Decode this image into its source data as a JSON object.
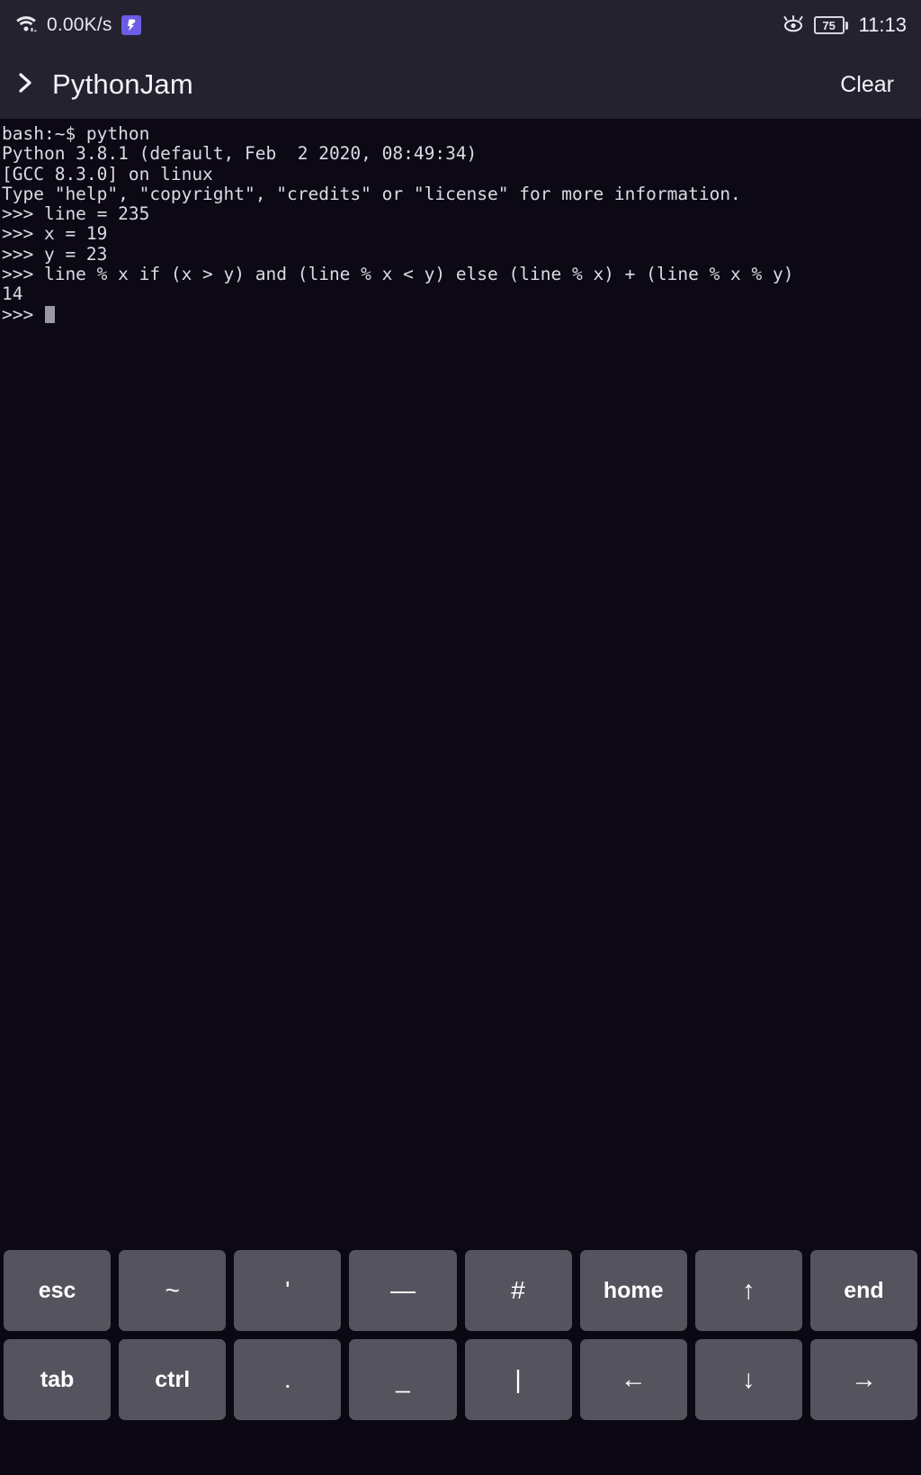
{
  "status_bar": {
    "network_speed": "0.00K/s",
    "wifi_icon": "wifi-icon",
    "app_notification_icon": "app-notification-icon",
    "eye_care_icon": "eye-care-icon",
    "battery_level": "75",
    "time": "11:13"
  },
  "app_header": {
    "back_icon": "chevron-right-icon",
    "title": "PythonJam",
    "clear_label": "Clear"
  },
  "terminal": {
    "lines": [
      "bash:~$ python",
      "Python 3.8.1 (default, Feb  2 2020, 08:49:34)",
      "[GCC 8.3.0] on linux",
      "Type \"help\", \"copyright\", \"credits\" or \"license\" for more information.",
      ">>> line = 235",
      ">>> x = 19",
      ">>> y = 23",
      ">>> line % x if (x > y) and (line % x < y) else (line % x) + (line % x % y)",
      "14"
    ],
    "prompt": ">>> ",
    "input_value": "",
    "cursor_visible": true
  },
  "keyboard": {
    "rows": [
      [
        {
          "label": "esc",
          "name": "key-esc",
          "style": "word"
        },
        {
          "label": "~",
          "name": "key-tilde",
          "style": "sym"
        },
        {
          "label": "'",
          "name": "key-apostrophe",
          "style": "sym"
        },
        {
          "label": "—",
          "name": "key-em-dash",
          "style": "sym"
        },
        {
          "label": "#",
          "name": "key-hash",
          "style": "sym"
        },
        {
          "label": "home",
          "name": "key-home",
          "style": "word"
        },
        {
          "label": "↑",
          "name": "key-arrow-up",
          "style": "arrow"
        },
        {
          "label": "end",
          "name": "key-end",
          "style": "word"
        }
      ],
      [
        {
          "label": "tab",
          "name": "key-tab",
          "style": "word"
        },
        {
          "label": "ctrl",
          "name": "key-ctrl",
          "style": "word"
        },
        {
          "label": ".",
          "name": "key-period",
          "style": "sym"
        },
        {
          "label": "_",
          "name": "key-underscore",
          "style": "sym"
        },
        {
          "label": "|",
          "name": "key-pipe",
          "style": "sym"
        },
        {
          "label": "←",
          "name": "key-arrow-left",
          "style": "arrow"
        },
        {
          "label": "↓",
          "name": "key-arrow-down",
          "style": "arrow"
        },
        {
          "label": "→",
          "name": "key-arrow-right",
          "style": "arrow"
        }
      ]
    ]
  },
  "colors": {
    "header_bg": "#252230",
    "terminal_bg": "#0c0915",
    "key_bg": "#55535d",
    "accent_purple": "#6c5ce7",
    "text": "#f4f2f8",
    "terminal_text": "#dcdae4"
  }
}
